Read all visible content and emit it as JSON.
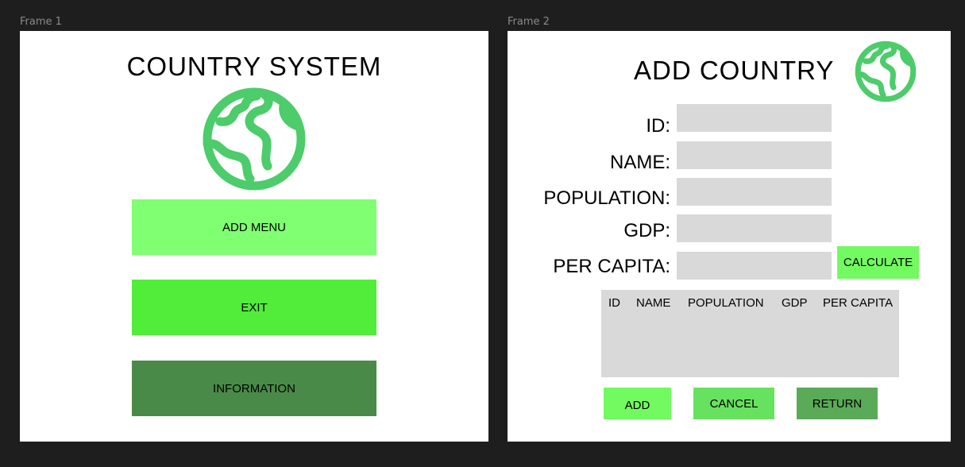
{
  "frame1": {
    "label": "Frame 1",
    "title": "COUNTRY SYSTEM",
    "icon": "globe-icon",
    "buttons": {
      "add_menu": "ADD MENU",
      "exit": "EXIT",
      "information": "INFORMATION"
    }
  },
  "frame2": {
    "label": "Frame 2",
    "title": "ADD COUNTRY",
    "icon": "globe-icon",
    "fields": {
      "id": {
        "label": "ID:",
        "value": ""
      },
      "name": {
        "label": "NAME:",
        "value": ""
      },
      "population": {
        "label": "POPULATION:",
        "value": ""
      },
      "gdp": {
        "label": "GDP:",
        "value": ""
      },
      "per_capita": {
        "label": "PER CAPITA:",
        "value": ""
      }
    },
    "calculate_label": "CALCULATE",
    "table": {
      "columns": [
        "ID",
        "NAME",
        "POPULATION",
        "GDP",
        "PER CAPITA"
      ]
    },
    "buttons": {
      "add": "ADD",
      "cancel": "CANCEL",
      "return": "RETURN"
    }
  },
  "colors": {
    "canvas": "#1e1e1e",
    "globe": "#4ccc6a",
    "btn_light": "#80ff72",
    "btn_bright": "#52ec3a",
    "btn_dark": "#4a8a48",
    "btn_add": "#72fa60",
    "btn_cancel": "#67e25f",
    "btn_return": "#5aaa58",
    "input_gray": "#d9d9d9"
  }
}
